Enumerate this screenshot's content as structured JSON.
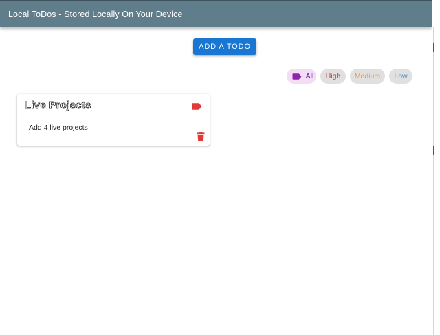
{
  "appbar": {
    "title": "Local ToDos - Stored Locally On Your Device"
  },
  "actions": {
    "add_label": "Add a todo"
  },
  "filters": {
    "items": [
      {
        "label": "All",
        "selected": true,
        "color": "#6a1b9a"
      },
      {
        "label": "High",
        "selected": false,
        "color": "#c0392b"
      },
      {
        "label": "Medium",
        "selected": false,
        "color": "#ef9a3a"
      },
      {
        "label": "Low",
        "selected": false,
        "color": "#4a8fd0"
      }
    ]
  },
  "todos": [
    {
      "title": "Live Projects",
      "description": "Add 4 live projects",
      "priority_color": "#e53935",
      "tag_icon": "label-icon",
      "delete_icon": "trash-icon"
    }
  ],
  "colors": {
    "appbar": "#607d8b",
    "primary": "#1976d2"
  }
}
